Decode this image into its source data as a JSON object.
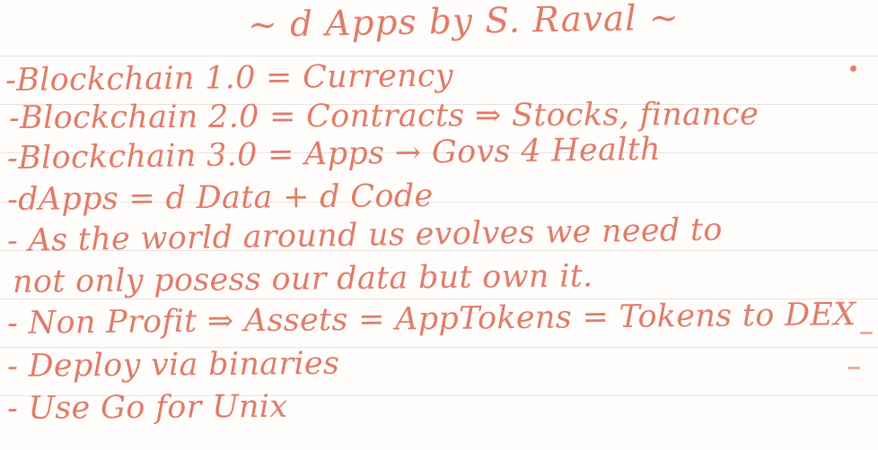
{
  "title": "~ d Apps by S. Raval ~",
  "lines": [
    "-Blockchain 1.0 = Currency",
    "-Blockchain 2.0 = Contracts ⇒ Stocks, finance",
    "-Blockchain 3.0 = Apps → Govs 4 Health",
    "-dApps = d Data + d Code",
    "- As the world around us evolves we need to",
    "not only posess our data but own it.",
    "- Non Profit ⇒ Assets = AppTokens = Tokens to DEX",
    "- Deploy via binaries",
    "- Use Go for Unix"
  ],
  "ink_color": "#e07c68"
}
